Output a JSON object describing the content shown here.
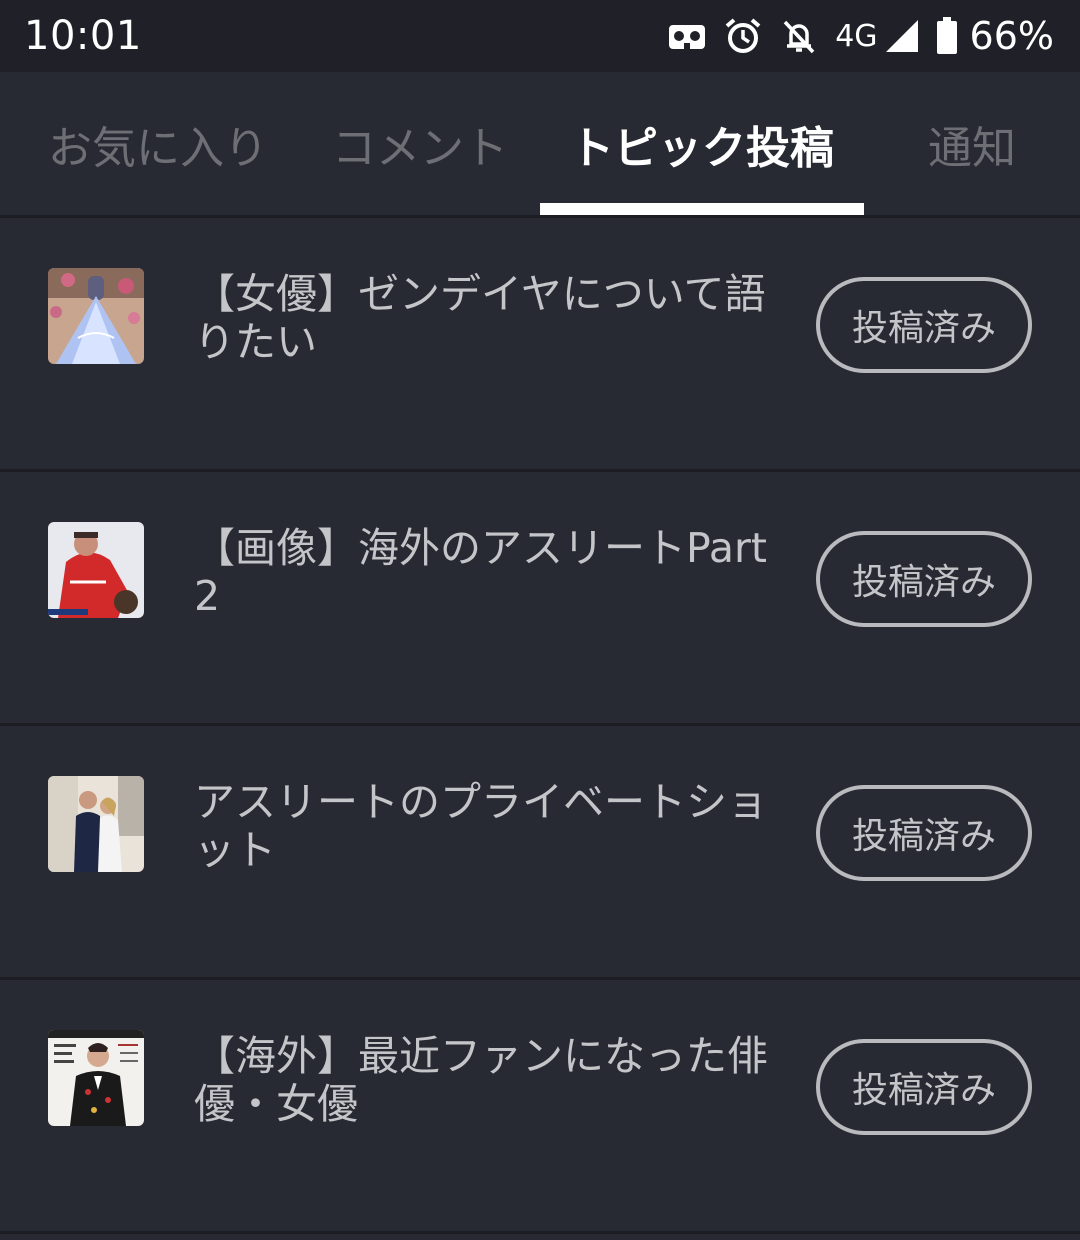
{
  "status_bar": {
    "time": "10:01",
    "icons": [
      "vr-icon",
      "alarm-icon",
      "notifications-off-icon",
      "signal-icon",
      "battery-icon"
    ],
    "network": "4G",
    "battery": "66%"
  },
  "tabs": [
    {
      "label": "お気に入り",
      "active": false
    },
    {
      "label": "コメント",
      "active": false
    },
    {
      "label": "トピック投稿",
      "active": true
    },
    {
      "label": "通知",
      "active": false
    }
  ],
  "topics": [
    {
      "title": "【女優】ゼンデイヤについて語りたい",
      "status": "投稿済み",
      "thumbnail": "gown-photo"
    },
    {
      "title": "【画像】海外のアスリートPart 2",
      "status": "投稿済み",
      "thumbnail": "baseball-player-photo"
    },
    {
      "title": "アスリートのプライベートショット",
      "status": "投稿済み",
      "thumbnail": "couple-photo"
    },
    {
      "title": "【海外】最近ファンになった俳優・女優",
      "status": "投稿済み",
      "thumbnail": "magazine-cover-photo"
    }
  ],
  "colors": {
    "background": "#282a33",
    "status_bar": "#202128",
    "divider": "#1c1d23",
    "active_tab": "#ffffff",
    "inactive_tab": "#6d6f75"
  }
}
